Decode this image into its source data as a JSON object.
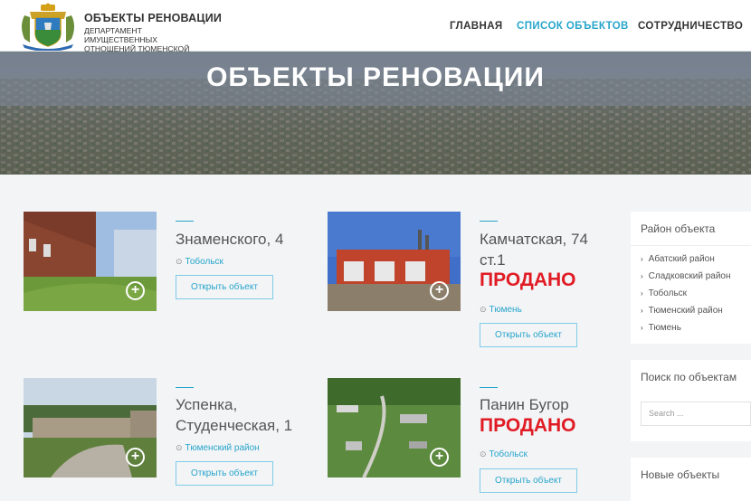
{
  "header": {
    "brand_title": "ОБЪЕКТЫ РЕНОВАЦИИ",
    "brand_subtitle_1": "ДЕПАРТАМЕНТ ИМУЩЕСТВЕННЫХ",
    "brand_subtitle_2": "ОТНОШЕНИЙ ТЮМЕНСКОЙ ОБЛАСТИ",
    "nav": [
      "ГЛАВНАЯ",
      "СПИСОК ОБЪЕКТОВ",
      "СОТРУДНИЧЕСТВО"
    ]
  },
  "hero": {
    "title": "ОБЪЕКТЫ РЕНОВАЦИИ"
  },
  "cards": [
    {
      "title_1": "Знаменского, 4",
      "title_2": "",
      "sold": "",
      "location": "Тобольск",
      "button": "Открыть объект"
    },
    {
      "title_1": "Камчатская, 74",
      "title_2": "ст.1",
      "sold": "ПРОДАНО",
      "location": "Тюмень",
      "button": "Открыть объект"
    },
    {
      "title_1": "Успенка,",
      "title_2": "Студенческая, 1",
      "sold": "",
      "location": "Тюменский район",
      "button": "Открыть объект"
    },
    {
      "title_1": "Панин Бугор",
      "title_2": "",
      "sold": "ПРОДАНО",
      "location": "Тобольск",
      "button": "Открыть объект"
    }
  ],
  "sidebar": {
    "district_title": "Район объекта",
    "districts": [
      "Абатский район",
      "Сладковский район",
      "Тобольск",
      "Тюменский район",
      "Тюмень"
    ],
    "search_title": "Поиск по объектам",
    "search_placeholder": "Search ...",
    "new_title": "Новые объекты"
  },
  "colors": {
    "accent": "#27a5cb",
    "sold": "#e01b24"
  }
}
